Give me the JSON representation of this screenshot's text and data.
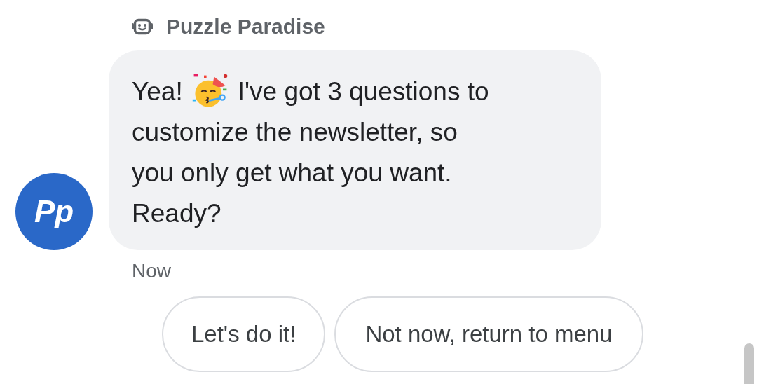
{
  "sender": {
    "name": "Puzzle Paradise",
    "avatar_text": "Pp"
  },
  "message": {
    "text_before": "Yea!",
    "text_after_icon": "I've got 3 questions to",
    "text_rest": "customize the newsletter, so you only get what you want. Ready?",
    "time": "Now"
  },
  "suggestions": [
    {
      "label": "Let's do it!"
    },
    {
      "label": "Not now, return to menu"
    }
  ]
}
